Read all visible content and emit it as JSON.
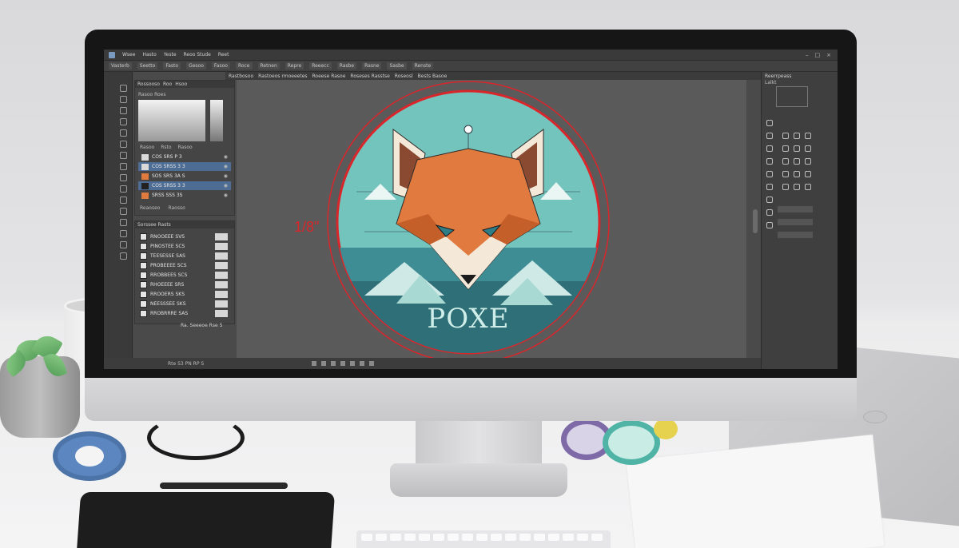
{
  "app": {
    "menu": [
      "Wsee",
      "Hasto",
      "Yeste",
      "Reoo Stude",
      "Reet"
    ],
    "options": [
      "Vasterb",
      "Seetto",
      "Fasto",
      "Gesoo",
      "Fasoo",
      "Roce",
      "Retnen",
      "Repre",
      "Reeecc",
      "Rasbe",
      "Rasne",
      "Sasbe",
      "Renste"
    ],
    "doc_tabs": [
      "Rastbosoo",
      "Rastoeos rmoeeetes",
      "Roeese Rasoe",
      "Roseses Rasstse",
      "Roseosl",
      "Bests Basoe"
    ]
  },
  "layers_panel": {
    "tabs": [
      "Rossooso",
      "Roo",
      "Hsoo"
    ],
    "preview_label": "Rasoo Roes",
    "sub_tabs": [
      "Rasoo",
      "Rsto",
      "Rasoo"
    ],
    "layers": [
      {
        "label": "COS SRS P 3",
        "active": false
      },
      {
        "label": "COS SRSS 3 3",
        "active": true
      },
      {
        "label": "SOS SRS 3A S",
        "active": false
      },
      {
        "label": "COS SRSS 3 3",
        "active": true
      },
      {
        "label": "SRSS SSS 3S",
        "active": false
      }
    ],
    "footer": [
      "Reaoseo",
      "Raosso"
    ]
  },
  "swatch_panel": {
    "title": "Sorssee Rasts",
    "rows": [
      "RNOOEEE SVS",
      "PINOSTEE SCS",
      "TEESESSE SAS",
      "PROBEEEE SCS",
      "RROBBEES SCS",
      "RHOEEEE SRS",
      "RROOERS SKS",
      "NEESSSEE SKS",
      "RROBRRRE SAS"
    ],
    "footer": "Ra. Seeeoe Rse S"
  },
  "status_bar": {
    "left": "Rte S3 PN RP S"
  },
  "canvas": {
    "dimension_annotation": "1/8\"",
    "logo_text": "POXE"
  },
  "right_panel": {
    "header": "Reerrpeass",
    "sub_header": "Lalkt"
  },
  "colors": {
    "ui_dark": "#3a3a3b",
    "canvas_bg": "#5a5a5b",
    "accent_layer": "#4d6d95",
    "logo_teal": "#74c4be",
    "fox_orange": "#e07a3e",
    "guide_red": "#d9262b"
  },
  "icons": [
    "window-minimize-icon",
    "window-maximize-icon",
    "window-close-icon",
    "eye-icon",
    "layer-thumbnail-icon",
    "tool-icon",
    "panel-tool-icon"
  ]
}
